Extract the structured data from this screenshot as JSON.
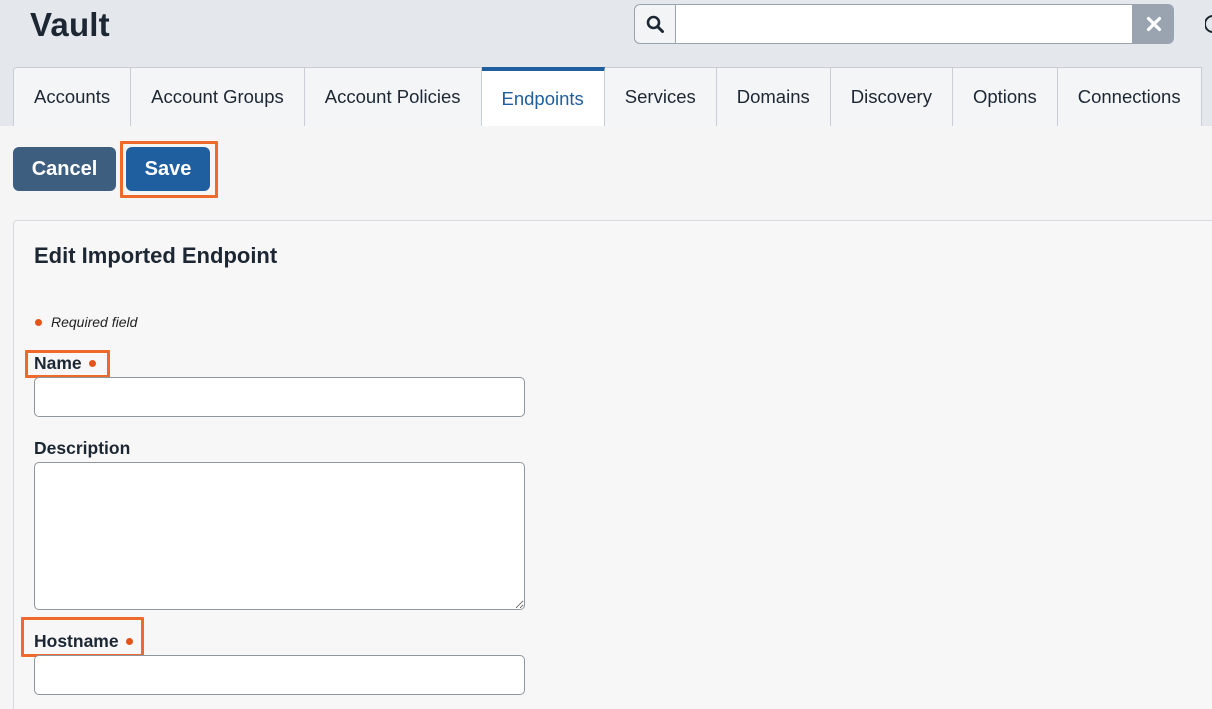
{
  "app": {
    "title": "Vault"
  },
  "search": {
    "value": "",
    "placeholder": ""
  },
  "tabs": [
    {
      "label": "Accounts",
      "active": false
    },
    {
      "label": "Account Groups",
      "active": false
    },
    {
      "label": "Account Policies",
      "active": false
    },
    {
      "label": "Endpoints",
      "active": true
    },
    {
      "label": "Services",
      "active": false
    },
    {
      "label": "Domains",
      "active": false
    },
    {
      "label": "Discovery",
      "active": false
    },
    {
      "label": "Options",
      "active": false
    },
    {
      "label": "Connections",
      "active": false
    }
  ],
  "toolbar": {
    "cancel_label": "Cancel",
    "save_label": "Save"
  },
  "form": {
    "title": "Edit Imported Endpoint",
    "required_note": "Required field",
    "fields": {
      "name": {
        "label": "Name",
        "value": "",
        "required": true
      },
      "description": {
        "label": "Description",
        "value": "",
        "required": false
      },
      "hostname": {
        "label": "Hostname",
        "value": "",
        "required": true
      }
    }
  },
  "colors": {
    "accent": "#1f5fa0",
    "active_tab": "#1f5f9e",
    "cancel": "#3e5e80",
    "required_dot": "#e4541a",
    "highlight": "#ef6a2a"
  },
  "icons": {
    "search": "search-icon",
    "clear": "close-icon"
  }
}
